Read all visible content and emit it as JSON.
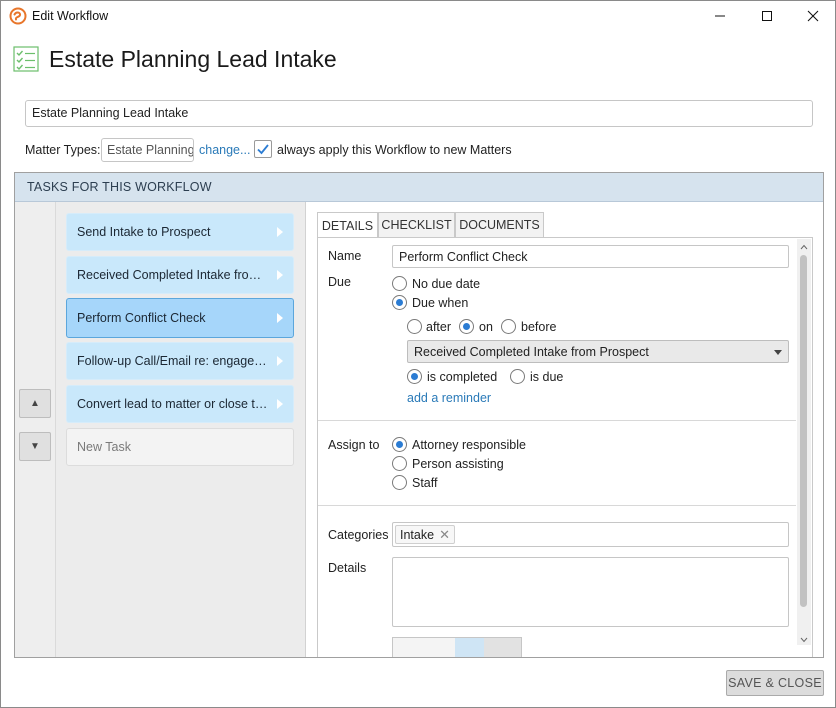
{
  "window": {
    "title": "Edit Workflow"
  },
  "header": {
    "title": "Estate Planning Lead Intake"
  },
  "workflow_name": "Estate Planning Lead Intake",
  "matter_types": {
    "label": "Matter Types:",
    "value": "Estate Planning",
    "change_link": "change...",
    "always_apply_label": "always apply this Workflow to new Matters",
    "always_apply_checked": true
  },
  "tasks_header": "TASKS FOR THIS WORKFLOW",
  "tasks": [
    {
      "label": "Send Intake to Prospect"
    },
    {
      "label": "Received Completed Intake from Prospect"
    },
    {
      "label": "Perform Conflict Check",
      "selected": true
    },
    {
      "label": "Follow-up Call/Email re: engagement"
    },
    {
      "label": "Convert lead to matter or close the lead"
    }
  ],
  "new_task_placeholder": "New Task",
  "tabs": [
    {
      "label": "DETAILS",
      "active": true
    },
    {
      "label": "CHECKLIST"
    },
    {
      "label": "DOCUMENTS"
    }
  ],
  "details": {
    "name_label": "Name",
    "name_value": "Perform Conflict Check",
    "due_label": "Due",
    "no_due_date": "No due date",
    "due_when": "Due when",
    "due_selected": "due_when",
    "after": "after",
    "on": "on",
    "before": "before",
    "timing_selected": "on",
    "reference_task": "Received Completed Intake from Prospect",
    "is_completed": "is completed",
    "is_due": "is due",
    "trigger_selected": "is_completed",
    "add_reminder": "add a reminder",
    "assign_label": "Assign to",
    "assign_options": [
      "Attorney responsible",
      "Person assisting",
      "Staff"
    ],
    "assign_selected": 0,
    "categories_label": "Categories",
    "categories": [
      "Intake"
    ],
    "details_label": "Details",
    "details_value": ""
  },
  "footer": {
    "save_close": "SAVE & CLOSE"
  },
  "colors": {
    "accent": "#2b7cd3",
    "task_bg": "#c9e8fb",
    "task_selected": "#a6d6fa",
    "header_band": "#d6e3ee"
  }
}
